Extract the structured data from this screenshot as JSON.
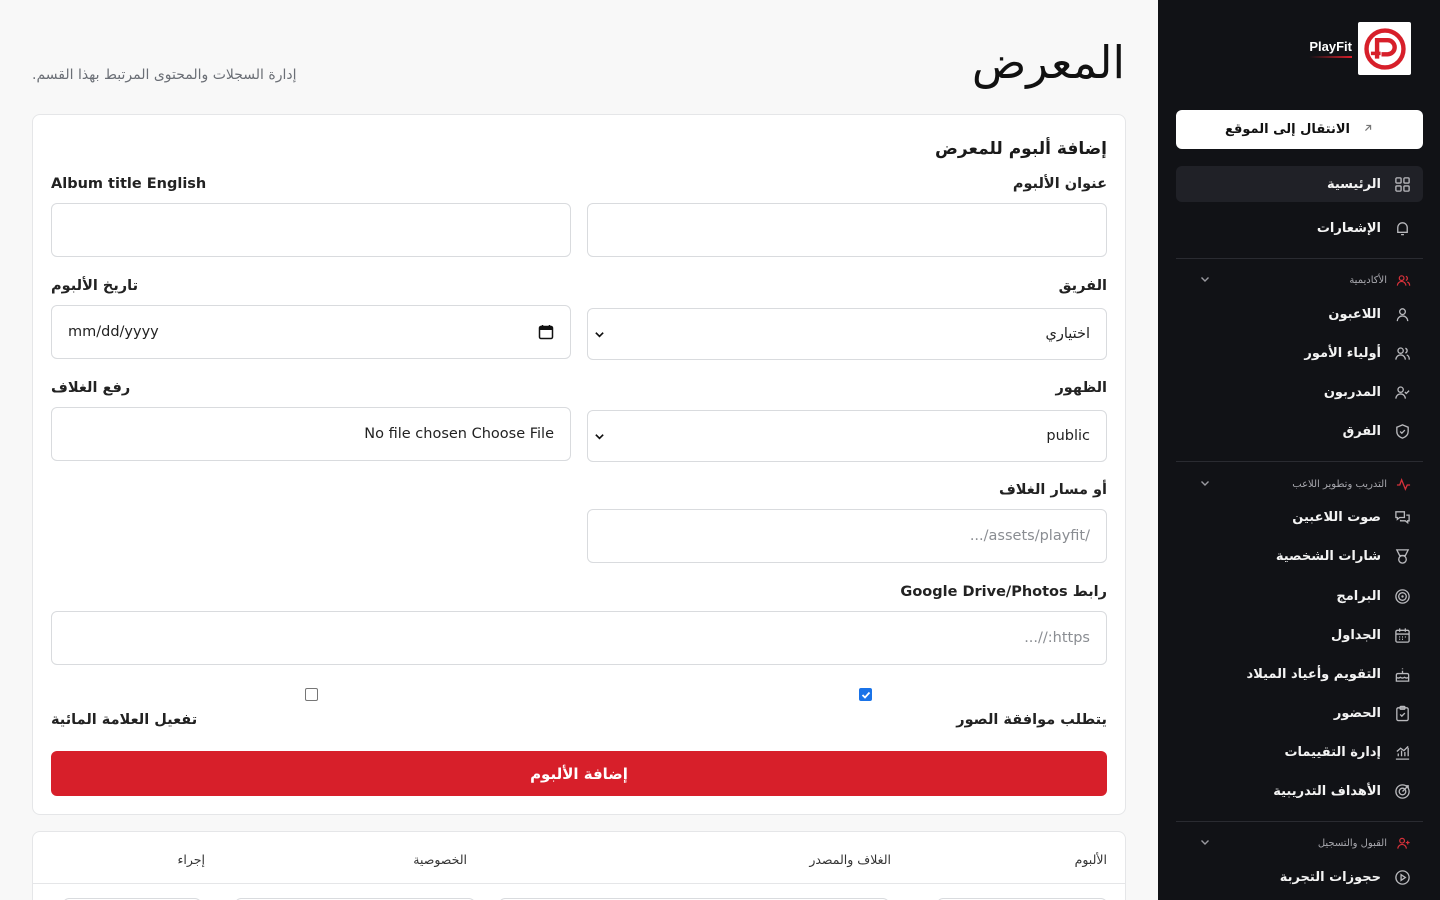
{
  "brand": {
    "name": "PlayFit"
  },
  "sidebar": {
    "goto_site": "الانتقال إلى الموقع",
    "top_items": [
      {
        "label": "الرئيسية",
        "icon": "grid-icon"
      },
      {
        "label": "الإشعارات",
        "icon": "bell-icon"
      }
    ],
    "groups": [
      {
        "title": "الأكاديمية",
        "icon": "users-icon",
        "items": [
          {
            "label": "اللاعبون",
            "icon": "user-icon"
          },
          {
            "label": "أولياء الأمور",
            "icon": "users-icon"
          },
          {
            "label": "المدربون",
            "icon": "user-check-icon"
          },
          {
            "label": "الفرق",
            "icon": "shield-icon"
          }
        ]
      },
      {
        "title": "التدريب وتطوير اللاعب",
        "icon": "activity-icon",
        "items": [
          {
            "label": "صوت اللاعبين",
            "icon": "chat-icon"
          },
          {
            "label": "شارات الشخصية",
            "icon": "badge-icon"
          },
          {
            "label": "البرامج",
            "icon": "target-icon"
          },
          {
            "label": "الجداول",
            "icon": "calendar-icon"
          },
          {
            "label": "التقويم وأعياد الميلاد",
            "icon": "cake-icon"
          },
          {
            "label": "الحضور",
            "icon": "clipboard-icon"
          },
          {
            "label": "إدارة التقييمات",
            "icon": "bar-chart-icon"
          },
          {
            "label": "الأهداف التدريبية",
            "icon": "goal-icon"
          }
        ]
      },
      {
        "title": "القبول والتسجيل",
        "icon": "user-plus-icon",
        "items": [
          {
            "label": "حجوزات التجربة",
            "icon": "play-circle-icon"
          }
        ]
      }
    ]
  },
  "page": {
    "title": "المعرض",
    "subtitle": "إدارة السجلات والمحتوى المرتبط بهذا القسم."
  },
  "form": {
    "card_title": "إضافة ألبوم للمعرض",
    "album_title_label": "عنوان الألبوم",
    "album_title_en_label": "Album title English",
    "team_label": "الفريق",
    "team_value": "اختياري",
    "date_label": "تاريخ الألبوم",
    "date_value": "mm/dd/yyyy",
    "visibility_label": "الظهور",
    "visibility_value": "public",
    "cover_upload_label": "رفع الغلاف",
    "cover_upload_value": "No file chosen Choose File",
    "cover_path_label": "أو مسار الغلاف",
    "cover_path_placeholder": "/assets/playfit/...",
    "drive_link_label": "رابط Google Drive/Photos",
    "drive_link_placeholder": "https://...",
    "require_approval_label": "يتطلب موافقة الصور",
    "require_approval_checked": true,
    "watermark_label": "تفعيل العلامة المائية",
    "watermark_checked": false,
    "submit_label": "إضافة الألبوم"
  },
  "table": {
    "headers": [
      "الألبوم",
      "الغلاف والمصدر",
      "الخصوصية",
      "إجراء"
    ]
  },
  "colors": {
    "accent": "#d71f2a",
    "sidebar_bg": "#111216",
    "checkbox_checked": "#1a73e8"
  }
}
